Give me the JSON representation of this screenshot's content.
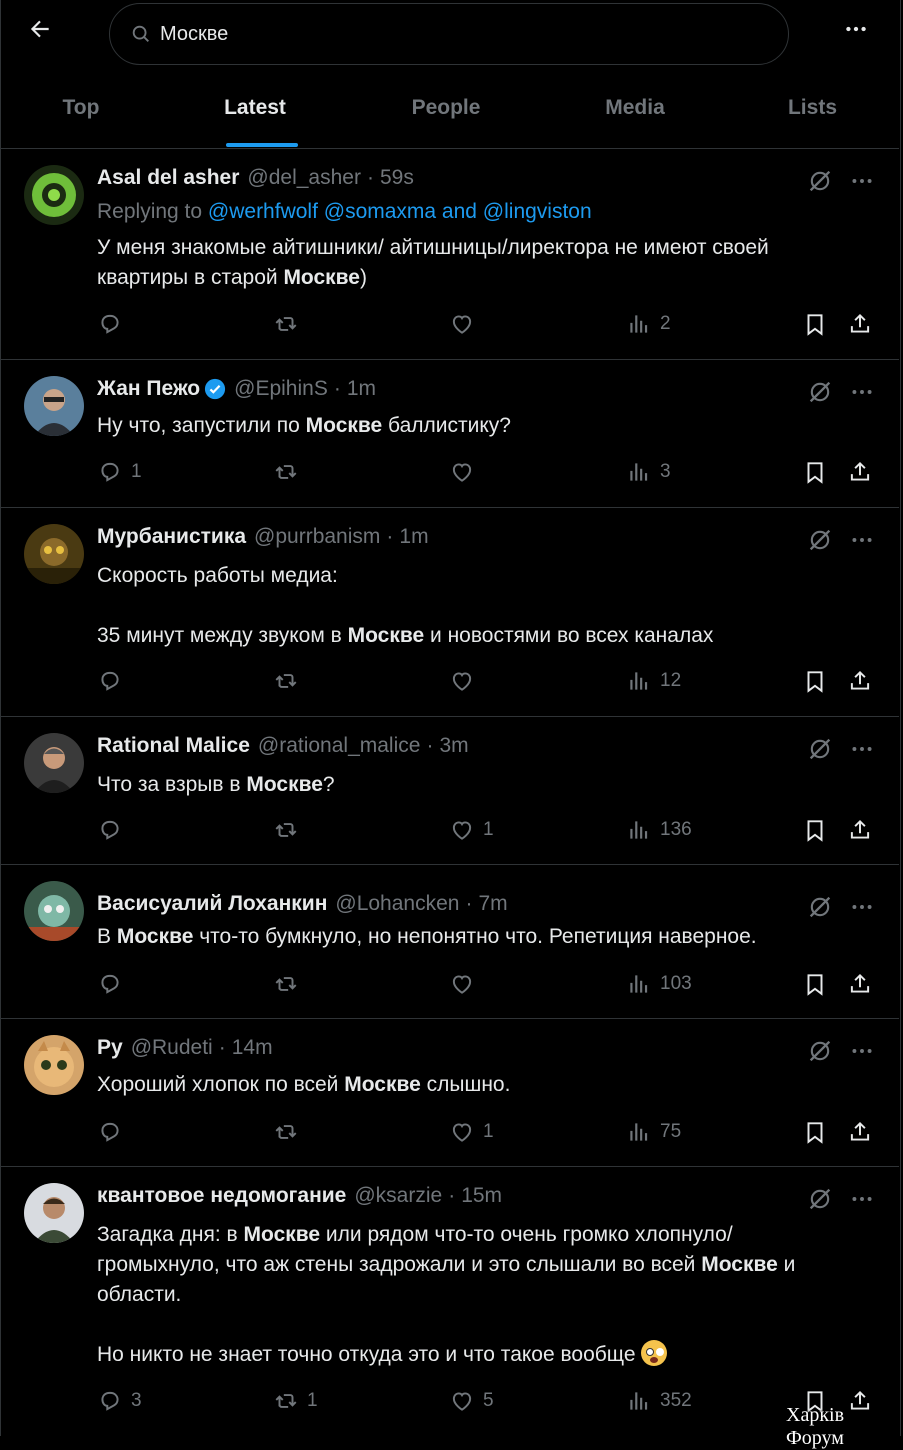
{
  "search": {
    "value": "Москве"
  },
  "tabs": [
    {
      "label": "Top",
      "active": false
    },
    {
      "label": "Latest",
      "active": true
    },
    {
      "label": "People",
      "active": false
    },
    {
      "label": "Media",
      "active": false
    },
    {
      "label": "Lists",
      "active": false
    }
  ],
  "colors": {
    "accent": "#1d9bf0",
    "muted": "#71767b",
    "text": "#e7e9ea",
    "background": "#000000",
    "border": "#2f3336"
  },
  "tweets": [
    {
      "name": "Asal del asher",
      "handle": "@del_asher",
      "time": "59s",
      "reply_prefix": "Replying to",
      "reply_to": "@werhfwolf @somaxma and @lingviston",
      "text_html": "У меня знакомые айтишники/ айтишницы/лиректора не имеют своей квартиры в старой <b>Москве</b>)",
      "replies": "",
      "reposts": "",
      "likes": "",
      "views": "2"
    },
    {
      "name": "Жан Пежо",
      "handle": "@EpihinS",
      "time": "1m",
      "verified": true,
      "text_html": "Ну что, запустили по <b>Москве</b> баллистику?",
      "replies": "1",
      "reposts": "",
      "likes": "",
      "views": "3"
    },
    {
      "name": "Мурбанистика",
      "handle": "@purrbanism",
      "time": "1m",
      "text_html": "Скорость работы медиа:\n\n35 минут между звуком в <b>Москве</b> и новостями во всех каналах",
      "replies": "",
      "reposts": "",
      "likes": "",
      "views": "12"
    },
    {
      "name": "Rational Malice",
      "handle": "@rational_malice",
      "time": "3m",
      "text_html": "Что за взрыв в <b>Москве</b>?",
      "replies": "",
      "reposts": "",
      "likes": "1",
      "views": "136"
    },
    {
      "name": "Васисуалий Лоханкин",
      "handle": "@Lohancken",
      "time": "7m",
      "text_html": "В <b>Москве</b> что-то бумкнуло, но непонятно что. Репетиция наверное.",
      "replies": "",
      "reposts": "",
      "likes": "",
      "views": "103"
    },
    {
      "name": "Ру",
      "handle": "@Rudeti",
      "time": "14m",
      "text_html": "Хороший хлопок по всей <b>Москве</b> слышно.",
      "replies": "",
      "reposts": "",
      "likes": "1",
      "views": "75"
    },
    {
      "name": "квантовое недомогание",
      "handle": "@ksarzie",
      "time": "15m",
      "text_html": "Загадка дня: в <b>Москве</b> или рядом что-то очень громко хлопнуло/ громыхнуло, что аж стены задрожали и это слышали во всей <b>Москве</b> и области.\n\nНо никто не знает точно откуда это и что такое вообще <span class=\"emoji\"></span>",
      "replies": "3",
      "reposts": "1",
      "likes": "5",
      "views": "352"
    }
  ],
  "watermark": "Харків Форум"
}
